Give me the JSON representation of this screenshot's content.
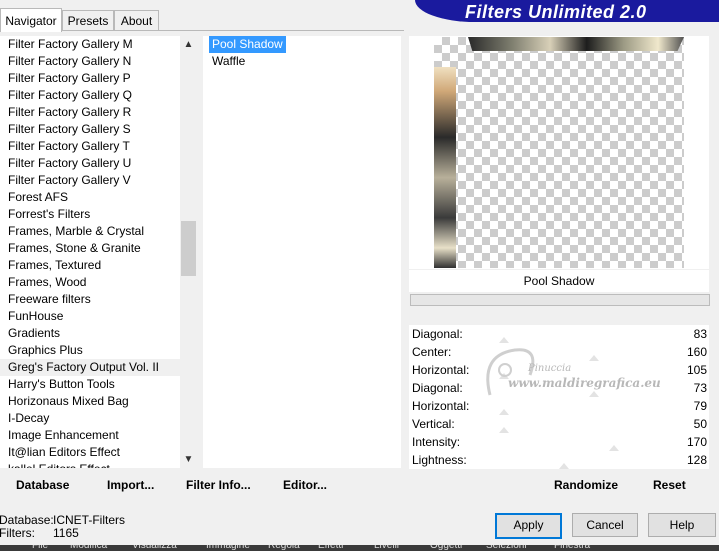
{
  "tabs": [
    {
      "label": "Navigator",
      "active": true
    },
    {
      "label": "Presets",
      "active": false
    },
    {
      "label": "About",
      "active": false
    }
  ],
  "header": {
    "title": "Filters Unlimited 2.0",
    "banner_color": "#1a1a9e"
  },
  "categories": [
    "Filter Factory Gallery M",
    "Filter Factory Gallery N",
    "Filter Factory Gallery P",
    "Filter Factory Gallery Q",
    "Filter Factory Gallery R",
    "Filter Factory Gallery S",
    "Filter Factory Gallery T",
    "Filter Factory Gallery U",
    "Filter Factory Gallery V",
    "Forest AFS",
    "Forrest's Filters",
    "Frames, Marble & Crystal",
    "Frames, Stone & Granite",
    "Frames, Textured",
    "Frames, Wood",
    "Freeware filters",
    "FunHouse",
    "Gradients",
    "Graphics Plus",
    "Greg's Factory Output Vol. II",
    "Harry's Button Tools",
    "Horizonaus Mixed Bag",
    "I-Decay",
    "Image Enhancement",
    "It@lian Editors Effect",
    "kallel Editors Effect"
  ],
  "selected_category_index": 19,
  "filters": [
    {
      "label": "Pool Shadow",
      "selected": true
    },
    {
      "label": "Waffle",
      "selected": false
    }
  ],
  "preview": {
    "filter_name": "Pool Shadow"
  },
  "parameters": [
    {
      "label": "Diagonal:",
      "value": "83"
    },
    {
      "label": "Center:",
      "value": "160"
    },
    {
      "label": "Horizontal:",
      "value": "105"
    },
    {
      "label": "Diagonal:",
      "value": "73"
    },
    {
      "label": "Horizontal:",
      "value": "79"
    },
    {
      "label": "Vertical:",
      "value": "50"
    },
    {
      "label": "Intensity:",
      "value": "170"
    },
    {
      "label": "Lightness:",
      "value": "128"
    }
  ],
  "actions": {
    "database": "Database",
    "import": "Import...",
    "filter_info": "Filter Info...",
    "editor": "Editor...",
    "randomize": "Randomize",
    "reset": "Reset"
  },
  "footer": {
    "database_label": "Database:",
    "database_value": "ICNET-Filters",
    "filters_label": "Filters:",
    "filters_value": "1165"
  },
  "dialog_buttons": {
    "apply": "Apply",
    "cancel": "Cancel",
    "help": "Help"
  },
  "watermark": {
    "line1": "Pinuccia",
    "line2": "www.maldiregrafica.eu"
  },
  "taskbar_items": [
    "File",
    "Modifica",
    "Visualizza",
    "Immagine",
    "Regola",
    "Effetti",
    "Livelli",
    "Oggetti",
    "Selezioni",
    "Finestra"
  ]
}
